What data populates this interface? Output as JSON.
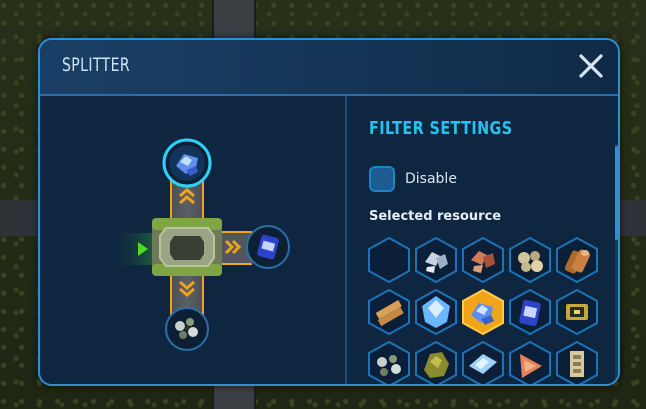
{
  "window": {
    "title": "SPLITTER"
  },
  "filter": {
    "title": "FILTER SETTINGS",
    "disable_label": "Disable",
    "disable_checked": false,
    "selected_label": "Selected resource"
  },
  "splitter": {
    "input_direction": "left",
    "outputs": [
      {
        "direction": "top",
        "resource": "blue-crystal"
      },
      {
        "direction": "right",
        "resource": "blue-canister"
      },
      {
        "direction": "bottom",
        "resource": "mixed-ore"
      }
    ]
  },
  "resources": [
    {
      "id": "empty",
      "selected": false
    },
    {
      "id": "iron-ore",
      "selected": false
    },
    {
      "id": "copper-ore",
      "selected": false
    },
    {
      "id": "stone",
      "selected": false
    },
    {
      "id": "wood-log",
      "selected": false
    },
    {
      "id": "wood-plank",
      "selected": false
    },
    {
      "id": "crystal",
      "selected": false
    },
    {
      "id": "blue-crystal",
      "selected": true
    },
    {
      "id": "blue-canister",
      "selected": false
    },
    {
      "id": "circuit",
      "selected": false
    },
    {
      "id": "mixed-ore",
      "selected": false
    },
    {
      "id": "sulfur",
      "selected": false
    },
    {
      "id": "glass",
      "selected": false
    },
    {
      "id": "copper-ingot",
      "selected": false
    },
    {
      "id": "brick",
      "selected": false
    }
  ],
  "colors": {
    "accent": "#29c0f0",
    "border": "#2f8fd0",
    "panel": "#0f2640",
    "selected_hex": "#f0a41a",
    "belt_chevron": "#f0a41a",
    "input_arrow": "#4bdc28"
  }
}
